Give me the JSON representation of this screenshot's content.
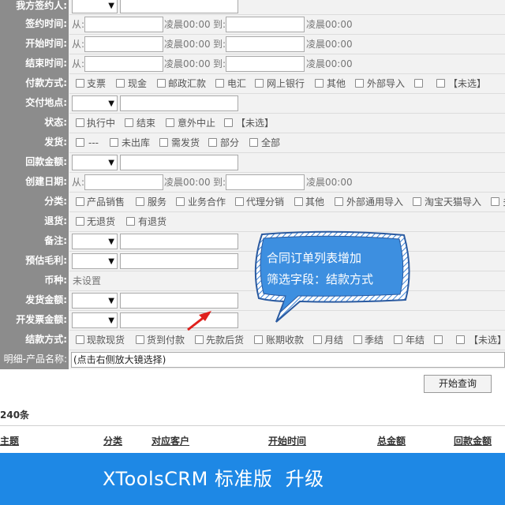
{
  "form": {
    "party_signer": {
      "label": "我方签约人:"
    },
    "sign_time": {
      "label": "签约时间:",
      "from": "从:",
      "to": "到:",
      "time_a": "凌晨00:00",
      "time_b": "凌晨00:00"
    },
    "start_time": {
      "label": "开始时间:",
      "from": "从:",
      "to": "到:",
      "time_a": "凌晨00:00",
      "time_b": "凌晨00:00"
    },
    "end_time": {
      "label": "结束时间:",
      "from": "从:",
      "to": "到:",
      "time_a": "凌晨00:00",
      "time_b": "凌晨00:00"
    },
    "pay_method": {
      "label": "付款方式:",
      "options": [
        "支票",
        "现金",
        "邮政汇款",
        "电汇",
        "网上银行",
        "其他",
        "外部导入",
        "",
        "【未选】"
      ]
    },
    "delivery_place": {
      "label": "交付地点:"
    },
    "status": {
      "label": "状态:",
      "options": [
        "执行中",
        "结束",
        "意外中止",
        "【未选】"
      ]
    },
    "shipping": {
      "label": "发货:",
      "options": [
        "---",
        "未出库",
        "需发货",
        "部分",
        "全部"
      ]
    },
    "payback_amount": {
      "label": "回款金额:"
    },
    "create_date": {
      "label": "创建日期:",
      "from": "从:",
      "to": "到:",
      "time_a": "凌晨00:00",
      "time_b": "凌晨00:00"
    },
    "category": {
      "label": "分类:",
      "options": [
        "产品销售",
        "服务",
        "业务合作",
        "代理分销",
        "其他",
        "外部通用导入",
        "淘宝天猫导入",
        "多"
      ]
    },
    "refund": {
      "label": "退货:",
      "options": [
        "无退货",
        "有退货"
      ]
    },
    "remark": {
      "label": "备注:"
    },
    "gross_profit": {
      "label": "预估毛利:"
    },
    "currency": {
      "label": "币种:",
      "value": "未设置"
    },
    "ship_amount": {
      "label": "发货金额:"
    },
    "invoice_amount": {
      "label": "开发票金额:"
    },
    "settle_method": {
      "label": "结款方式:",
      "options": [
        "现款现货",
        "货到付款",
        "先款后货",
        "账期收款",
        "月结",
        "季结",
        "年结",
        "",
        "【未选】"
      ]
    },
    "product_name": {
      "label": "明细-产品名称:",
      "value": "(点击右侧放大镜选择)"
    }
  },
  "callout": {
    "line1": "合同订单列表增加",
    "line2": "筛选字段：结款方式"
  },
  "search_button": "开始查询",
  "result_count": "240条",
  "columns": [
    "主题",
    "分类",
    "对应客户",
    "开始时间",
    "总金额",
    "回款金额"
  ],
  "banner": "XToolsCRM 标准版  升级",
  "colors": {
    "label_bg": "#8c8c8c",
    "banner": "#1e88e5",
    "callout": "#3d8fe0",
    "arrow": "#e0201c"
  }
}
